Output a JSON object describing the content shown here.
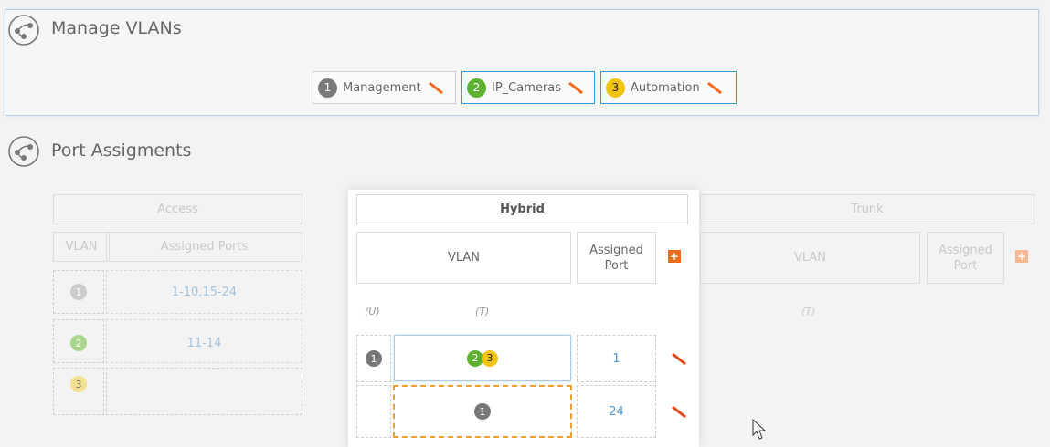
{
  "manage_vlans": {
    "title": "Manage VLANs",
    "vlans": [
      {
        "num": "1",
        "name": "Management",
        "color": "#7a7a7a"
      },
      {
        "num": "2",
        "name": "IP_Cameras",
        "color": "#5db231"
      },
      {
        "num": "3",
        "name": "Automation",
        "color": "#f1c40f"
      }
    ]
  },
  "port_assignments": {
    "title": "Port Assigments",
    "access": {
      "header": "Access",
      "col_vlan": "VLAN",
      "col_ports": "Assigned Ports",
      "rows": [
        {
          "vlan": "1",
          "ports": "1-10,15-24"
        },
        {
          "vlan": "2",
          "ports": "11-14"
        },
        {
          "vlan": "3",
          "ports": ""
        }
      ]
    },
    "hybrid": {
      "header": "Hybrid",
      "col_vlan": "VLAN",
      "col_port": "Assigned Port",
      "label_u": "(U)",
      "label_t": "(T)",
      "rows": [
        {
          "untagged": "1",
          "tagged": [
            "2",
            "3"
          ],
          "port": "1"
        },
        {
          "untagged": "",
          "tagged": [
            "1"
          ],
          "port": "24"
        }
      ]
    },
    "trunk": {
      "header": "Trunk",
      "col_vlan": "VLAN",
      "col_port": "Assigned Port",
      "label_t": "(T)"
    }
  },
  "colors": {
    "accent_orange": "#f06b1d",
    "active_border": "#3a9bd8"
  }
}
